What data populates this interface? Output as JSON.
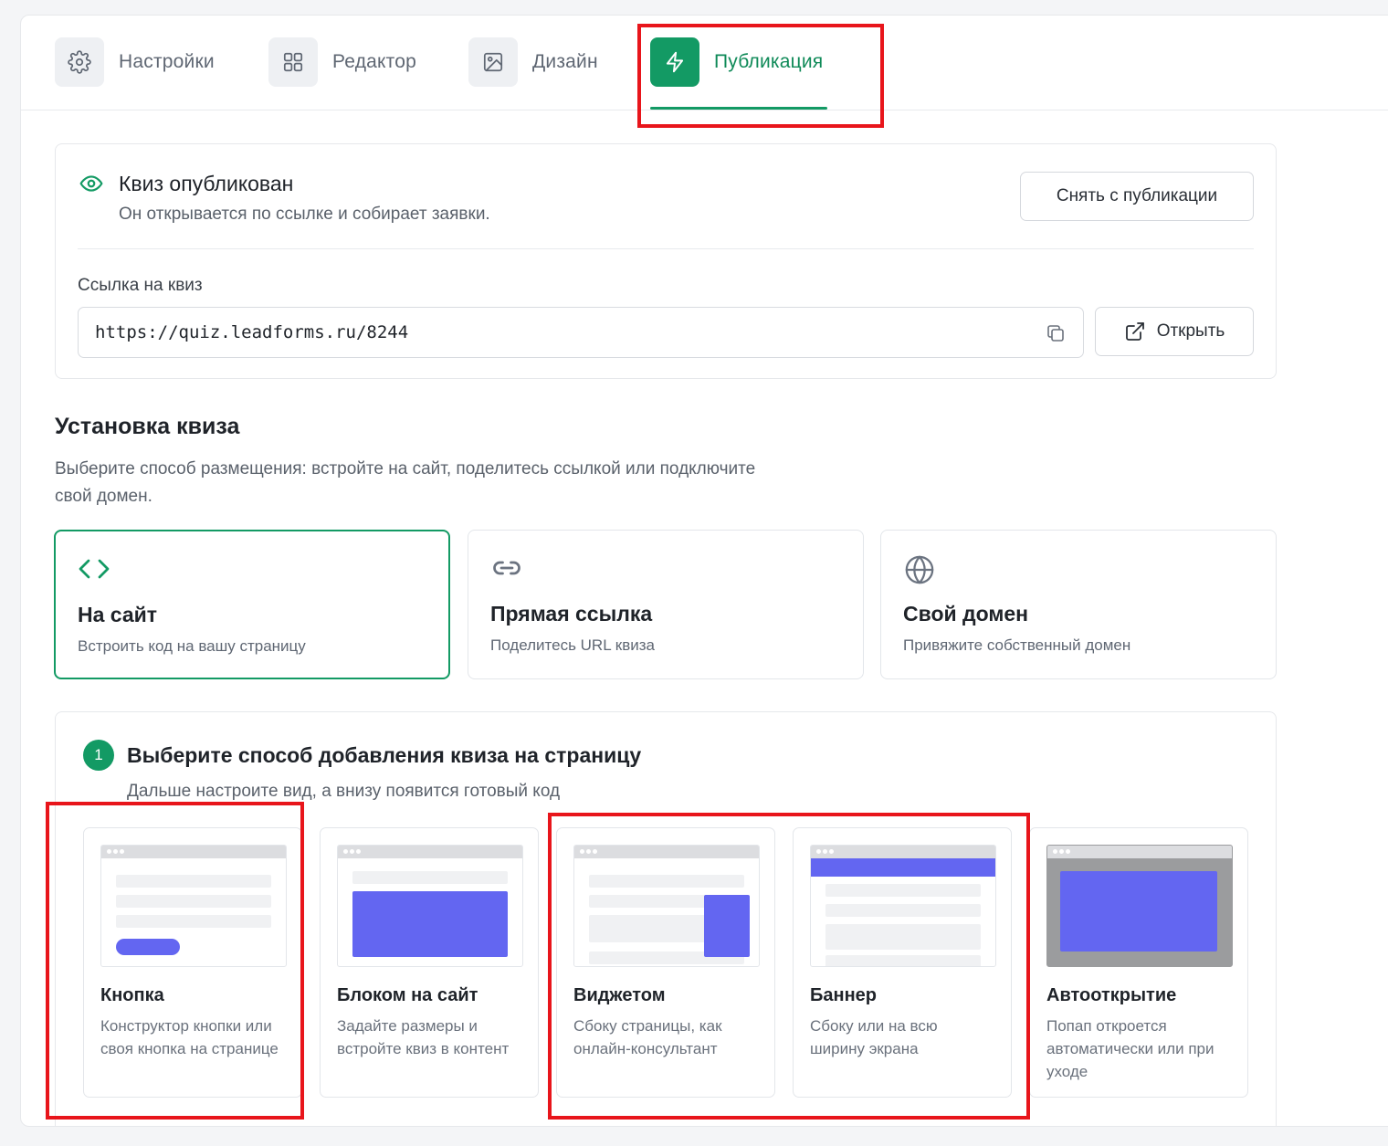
{
  "tabs": [
    {
      "label": "Настройки",
      "icon": "gear-icon"
    },
    {
      "label": "Редактор",
      "icon": "grid-icon"
    },
    {
      "label": "Дизайн",
      "icon": "image-icon"
    },
    {
      "label": "Публикация",
      "icon": "lightning-icon",
      "active": true
    }
  ],
  "published": {
    "title": "Квиз опубликован",
    "subtitle": "Он открывается по ссылке и собирает заявки.",
    "unpublish_label": "Снять с публикации",
    "link_label": "Ссылка на квиз",
    "link_value": "https://quiz.leadforms.ru/8244",
    "open_label": "Открыть"
  },
  "install": {
    "title": "Установка квиза",
    "subtitle": "Выберите способ размещения: встройте на сайт, поделитесь ссылкой или подключите свой домен.",
    "methods": [
      {
        "title": "На сайт",
        "desc": "Встроить код на вашу страницу",
        "icon": "code-icon",
        "selected": true
      },
      {
        "title": "Прямая ссылка",
        "desc": "Поделитесь URL квиза",
        "icon": "link-icon"
      },
      {
        "title": "Свой домен",
        "desc": "Привяжите собственный домен",
        "icon": "globe-icon"
      }
    ]
  },
  "embed": {
    "step": "1",
    "title": "Выберите способ добавления квиза на страницу",
    "subtitle": "Дальше настроите вид, а внизу появится готовый код",
    "options": [
      {
        "title": "Кнопка",
        "desc": "Конструктор кнопки или своя кнопка на странице"
      },
      {
        "title": "Блоком на сайт",
        "desc": "Задайте размеры и встройте квиз в контент"
      },
      {
        "title": "Виджетом",
        "desc": "Сбоку страницы, как онлайн-консультант"
      },
      {
        "title": "Баннер",
        "desc": "Сбоку или на всю ширину экрана"
      },
      {
        "title": "Автооткрытие",
        "desc": "Попап откроется автоматически или при уходе"
      }
    ]
  },
  "colors": {
    "accent_green": "#139a64",
    "preview_purple": "#6366f1",
    "annotation_red": "#e8151b"
  }
}
